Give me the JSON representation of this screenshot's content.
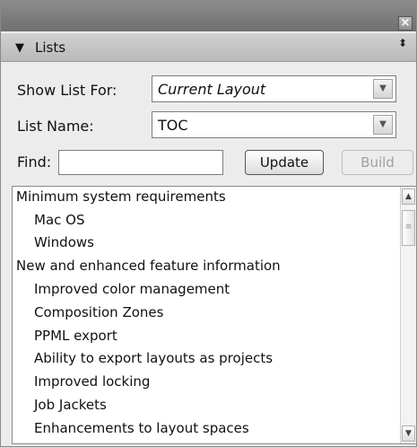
{
  "titlebar": {
    "close_icon": "×"
  },
  "section": {
    "label": "Lists",
    "collapse_icon": "▼",
    "updown_icon": "⬍"
  },
  "fields": {
    "show_list_for_label": "Show List For:",
    "show_list_for_value": "Current Layout",
    "list_name_label": "List Name:",
    "list_name_value": "TOC",
    "find_label": "Find:",
    "find_value": ""
  },
  "buttons": {
    "update": "Update",
    "build": "Build"
  },
  "list": {
    "items": [
      {
        "text": "Minimum system requirements",
        "level": 0
      },
      {
        "text": "Mac OS",
        "level": 1
      },
      {
        "text": "Windows",
        "level": 1
      },
      {
        "text": "New and enhanced feature information",
        "level": 0
      },
      {
        "text": "Improved color management",
        "level": 1
      },
      {
        "text": "Composition Zones",
        "level": 1
      },
      {
        "text": "PPML export",
        "level": 1
      },
      {
        "text": "Ability to export layouts as projects",
        "level": 1
      },
      {
        "text": "Improved locking",
        "level": 1
      },
      {
        "text": "Job Jackets",
        "level": 1
      },
      {
        "text": "Enhancements to layout spaces",
        "level": 1
      }
    ]
  },
  "icons": {
    "dropdown": "chevron-down-icon",
    "scroll_up": "▲",
    "scroll_down": "▼",
    "thumb_grip": "≡"
  }
}
